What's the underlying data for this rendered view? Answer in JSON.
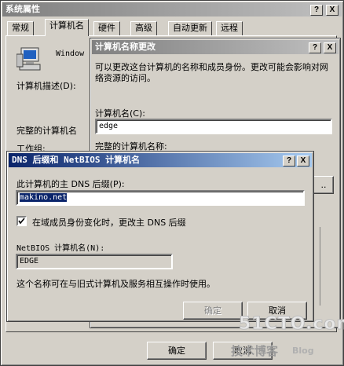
{
  "back_window": {
    "title": "系统属性",
    "tabs": [
      "常规",
      "计算机名",
      "硬件",
      "高级",
      "自动更新",
      "远程"
    ],
    "os_text": "Window",
    "desc_label": "计算机描述(D):",
    "full_name_label": "完整的计算机名",
    "workgroup_label": "工作组:",
    "ok_label": "确定",
    "cancel_label": "取消"
  },
  "mid_window": {
    "title": "计算机名称更改",
    "intro_text": "可以更改这台计算机的名称和成员身份。更改可能会影响对网络资源的访问。",
    "name_label": "计算机名(C):",
    "name_value": "edge",
    "full_name_label": "完整的计算机名称:"
  },
  "dns_dialog": {
    "title": "DNS 后缀和 NetBIOS 计算机名",
    "suffix_label": "此计算机的主 DNS 后缀(P):",
    "suffix_value": "makino.net",
    "checkbox_label": "在域成员身份变化时，更改主 DNS 后缀",
    "checkbox_checked": true,
    "netbios_label": "NetBIOS 计算机名(N):",
    "netbios_value": "EDGE",
    "info_text": "这个名称可在与旧式计算机及服务相互操作时使用。",
    "ok_label": "确定",
    "cancel_label": "取消"
  },
  "title_buttons": {
    "help": "?",
    "close": "X"
  },
  "watermark": {
    "main": "51CTO.com",
    "sub": "技术博客",
    "blog": "Blog"
  }
}
